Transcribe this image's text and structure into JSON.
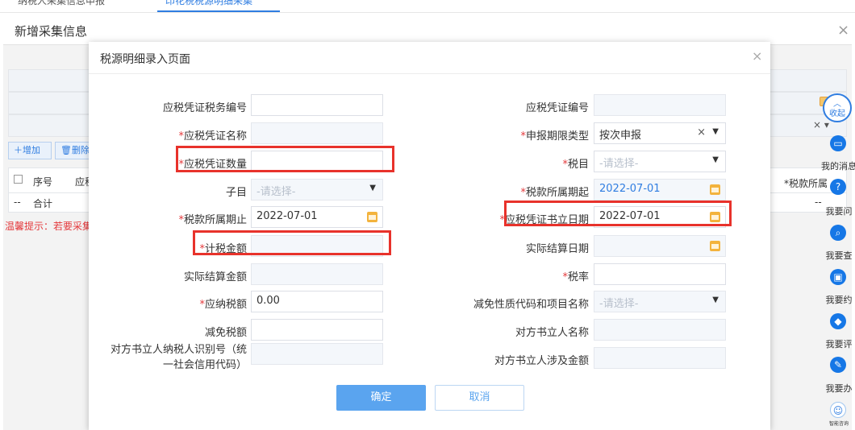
{
  "top_tabs": [
    {
      "label": "纳税人采集信息申报"
    },
    {
      "label": "印花税税源明细采集"
    }
  ],
  "outer": {
    "title": "新增采集信息",
    "close": "×"
  },
  "background": {
    "add_label": "增加",
    "delete_label": "删除",
    "col_check": "",
    "col_seq": "序号",
    "col_name": "应税",
    "col_right": "*税款所属",
    "total_dash": "--",
    "total_label": "合计",
    "right_dash": "--",
    "tip": "温馨提示：若要采集"
  },
  "help_bar": {
    "collapse": "收起",
    "items": [
      {
        "label": "我的消息",
        "icon": "message-icon"
      },
      {
        "label": "我要问",
        "icon": "question-icon"
      },
      {
        "label": "我要查",
        "icon": "search-icon"
      },
      {
        "label": "我要约",
        "icon": "calendar-icon"
      },
      {
        "label": "我要评",
        "icon": "rate-icon"
      },
      {
        "label": "我要办",
        "icon": "edit-icon"
      },
      {
        "label": "智能咨询",
        "icon": "robot-icon"
      }
    ]
  },
  "modal": {
    "title": "税源明细录入页面",
    "close": "×",
    "left_fields": [
      {
        "label": "应税凭证税务编号",
        "required": false,
        "value": "",
        "placeholder": "",
        "type": "text",
        "disabled": false
      },
      {
        "label": "应税凭证名称",
        "required": true,
        "value": "",
        "placeholder": "",
        "type": "text",
        "disabled": true
      },
      {
        "label": "应税凭证数量",
        "required": true,
        "value": "",
        "placeholder": "",
        "type": "text",
        "disabled": false
      },
      {
        "label": "子目",
        "required": false,
        "value": "",
        "placeholder": "-请选择-",
        "type": "select",
        "disabled": true
      },
      {
        "label": "税款所属期止",
        "required": true,
        "value": "2022-07-01",
        "placeholder": "",
        "type": "date",
        "disabled": false
      },
      {
        "label": "计税金额",
        "required": true,
        "value": "",
        "placeholder": "",
        "type": "text",
        "disabled": true
      },
      {
        "label": "实际结算金额",
        "required": false,
        "value": "",
        "placeholder": "",
        "type": "text",
        "disabled": true
      },
      {
        "label": "应纳税额",
        "required": true,
        "value": "0.00",
        "placeholder": "",
        "type": "text",
        "disabled": false
      },
      {
        "label": "减免税额",
        "required": false,
        "value": "",
        "placeholder": "",
        "type": "text",
        "disabled": false
      },
      {
        "label": "对方书立人纳税人识别号（统一社会信用代码）",
        "required": false,
        "value": "",
        "placeholder": "",
        "type": "text",
        "disabled": true
      }
    ],
    "right_fields": [
      {
        "label": "应税凭证编号",
        "required": false,
        "value": "",
        "placeholder": "",
        "type": "text",
        "disabled": true
      },
      {
        "label": "申报期限类型",
        "required": true,
        "value": "按次申报",
        "placeholder": "",
        "type": "select-clear",
        "disabled": false
      },
      {
        "label": "税目",
        "required": true,
        "value": "",
        "placeholder": "-请选择-",
        "type": "select",
        "disabled": false
      },
      {
        "label": "税款所属期起",
        "required": true,
        "value": "2022-07-01",
        "placeholder": "",
        "type": "date-blue",
        "disabled": true
      },
      {
        "label": "应税凭证书立日期",
        "required": true,
        "value": "2022-07-01",
        "placeholder": "",
        "type": "date",
        "disabled": false
      },
      {
        "label": "实际结算日期",
        "required": false,
        "value": "",
        "placeholder": "",
        "type": "date",
        "disabled": true
      },
      {
        "label": "税率",
        "required": true,
        "value": "",
        "placeholder": "",
        "type": "text",
        "disabled": false
      },
      {
        "label": "减免性质代码和项目名称",
        "required": false,
        "value": "",
        "placeholder": "-请选择-",
        "type": "select",
        "disabled": true
      },
      {
        "label": "对方书立人名称",
        "required": false,
        "value": "",
        "placeholder": "",
        "type": "text",
        "disabled": true
      },
      {
        "label": "对方书立人涉及金额",
        "required": false,
        "value": "",
        "placeholder": "",
        "type": "text",
        "disabled": true
      }
    ],
    "ok_label": "确定",
    "cancel_label": "取消"
  },
  "colors": {
    "accent": "#2f7de1",
    "highlight": "#e8322b",
    "required": "#e4393c",
    "ok_button": "#5aa4ef"
  }
}
